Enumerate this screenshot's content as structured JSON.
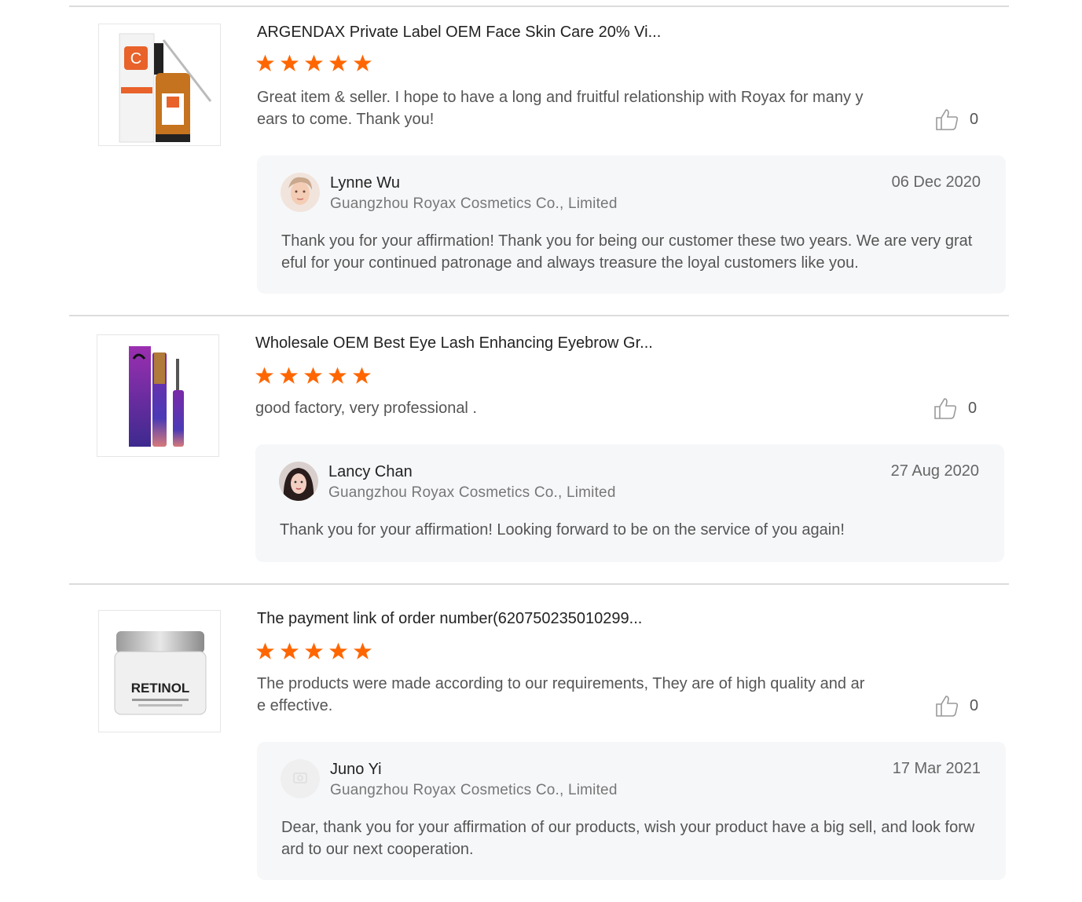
{
  "colors": {
    "star": "#ff6600",
    "divider": "#dcdcdc",
    "reply_bg": "#f6f7f9"
  },
  "reviews": [
    {
      "product_title": "ARGENDAX Private Label OEM Face Skin Care 20% Vi...",
      "rating": 5,
      "comment": "Great item & seller. I hope to have a long and fruitful relationship with Royax for many years to come. Thank you!",
      "likes": "0",
      "reply": {
        "name": "Lynne Wu",
        "company": "Guangzhou Royax Cosmetics Co., Limited",
        "date": "06 Dec 2020",
        "text": "Thank you for your affirmation! Thank you for being our customer these two years. We are very grateful for your continued patronage and always treasure the loyal customers like you."
      }
    },
    {
      "product_title": "Wholesale OEM Best Eye Lash Enhancing Eyebrow Gr...",
      "rating": 5,
      "comment": "good factory, very professional .",
      "likes": "0",
      "reply": {
        "name": "Lancy Chan",
        "company": "Guangzhou Royax Cosmetics Co., Limited",
        "date": "27 Aug 2020",
        "text": "Thank you for your affirmation! Looking forward to be on the service of you again!"
      }
    },
    {
      "product_title": "The payment link of order number(620750235010299...",
      "rating": 5,
      "comment": "The products were made according to our requirements, They are of high quality and are effective.",
      "likes": "0",
      "product_image_text": "RETINOL",
      "reply": {
        "name": "Juno Yi",
        "company": "Guangzhou Royax Cosmetics Co., Limited",
        "date": "17 Mar 2021",
        "text": "Dear, thank you for your affirmation of our products, wish your product have a big sell, and look forward to our next cooperation."
      }
    }
  ]
}
